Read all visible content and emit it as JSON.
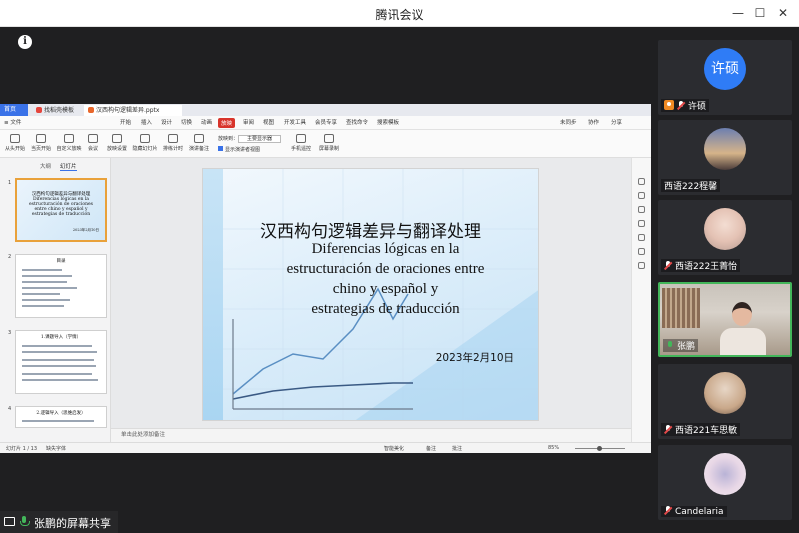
{
  "window": {
    "title": "腾讯会议",
    "minimize": "—",
    "maximize": "☐",
    "close": "✕"
  },
  "wps": {
    "tabs": {
      "home": "首页",
      "template": "找稻壳模板",
      "doc": "汉西构句逻辑差异.pptx"
    },
    "menu": [
      "≡ 文件",
      "开始",
      "插入",
      "设计",
      "切换",
      "动画",
      "放映",
      "审阅",
      "视图",
      "开发工具",
      "会员专享",
      "查找命令",
      "搜索模板"
    ],
    "menu_active": "放映",
    "menu_right": [
      "未同步",
      "协作",
      "分享"
    ],
    "ribbon": [
      "从头开始",
      "当页开始",
      "自定义放映",
      "会议",
      "放映设置",
      "隐藏幻灯片",
      "排练计时",
      "演讲备注"
    ],
    "ribbon_options": {
      "monitor_label": "放映到：",
      "monitor_value": "主要显示器",
      "show_presenter": "显示演讲者视图",
      "phone_remote": "手机遥控",
      "screen_record": "屏幕录制"
    },
    "thumb_tabs": [
      "大纲",
      "幻灯片"
    ],
    "thumbnails": [
      {
        "num": "1",
        "text": "汉西构句逻辑差异与翻译处理 Diferencias lógicas en la estructuración de oraciones entre chino y español y estrategias de traducción",
        "date": "2023年2月10日"
      },
      {
        "num": "2",
        "title": "目录"
      },
      {
        "num": "3",
        "title": "1.课题导入（学情）"
      },
      {
        "num": "4",
        "title": "2.逻辑导入（思维启发）"
      }
    ],
    "notes_placeholder": "单击此处添加备注",
    "status": {
      "slide_count": "幻灯片 1 / 13",
      "font_missing": "缺失字体",
      "smart": "智能美化",
      "notes": "备注",
      "comment": "批注",
      "zoom": "85%"
    }
  },
  "slide": {
    "title_cn": "汉西构句逻辑差异与翻译处理",
    "title_es_1": "Diferencias lógicas en la",
    "title_es_2": "estructuración de oraciones entre",
    "title_es_3": "chino y español y",
    "title_es_4": "estrategias de traducción",
    "date": "2023年2月10日"
  },
  "participants": [
    {
      "name": "许硕",
      "avatar_text": "许硕",
      "host": true,
      "muted": true
    },
    {
      "name": "西语222程馨",
      "muted": false
    },
    {
      "name": "西语222王菁怡",
      "muted": true
    },
    {
      "name": "张鹏",
      "muted": false,
      "speaking": true
    },
    {
      "name": "西语221车思敏",
      "muted": true
    },
    {
      "name": "Candelaria",
      "muted": true
    }
  ],
  "share_label": "张鹏的屏幕共享",
  "colors": {
    "accent_blue": "#2f7cf6",
    "speaking_green": "#43b65a",
    "wps_red": "#d8342b",
    "muted_red": "#e34949"
  }
}
